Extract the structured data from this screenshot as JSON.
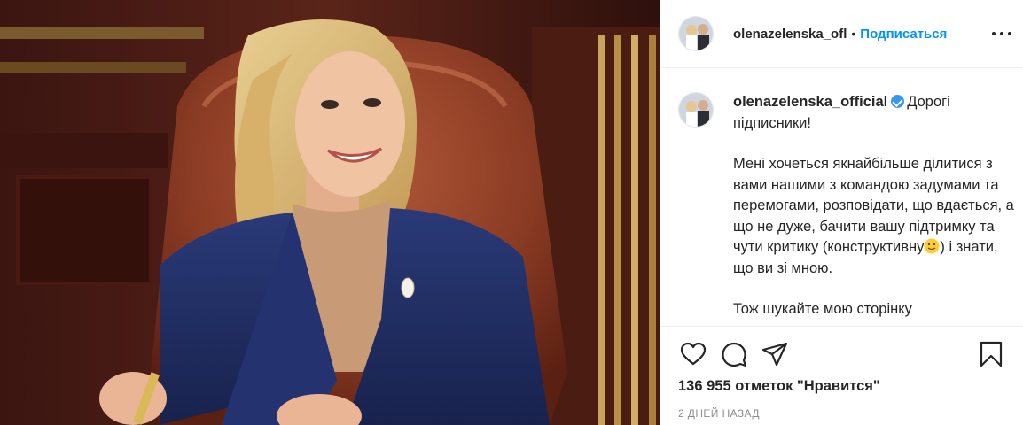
{
  "post": {
    "image_alt": "Olena Zelenska smiling at a desk in an office",
    "header": {
      "username": "olenazelenska_ofl",
      "separator": "•",
      "follow_label": "Подписаться"
    },
    "caption": {
      "username": "olenazelenska_official",
      "verified": true,
      "first_line": "Дорогі підписники!",
      "paragraph": "Мені хочеться якнайбільше ділитися з вами нашими з командою задумами та перемогами, розповідати, що вдається, а що не дуже, бачити вашу підтримку та чути критику (конструктивну",
      "paragraph_end": ") і знати, що ви зі мною.",
      "emoji": "slightly-smiling-face",
      "next_paragraph_partial": "Тож шукайте мою сторінку"
    },
    "actions": {
      "like": "heart-icon",
      "comment": "comment-icon",
      "share": "share-icon",
      "save": "bookmark-icon"
    },
    "likes_text": "136 955 отметок \"Нравится\"",
    "time_ago": "2 ДНЕЙ НАЗАД"
  },
  "colors": {
    "follow": "#0095f6",
    "verified": "#3897f0",
    "text": "#262626",
    "muted": "#8e8e8e"
  }
}
